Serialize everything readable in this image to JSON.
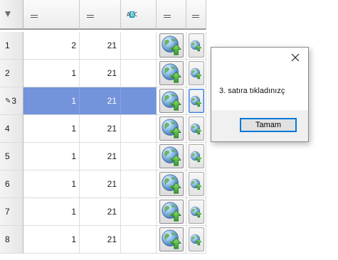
{
  "grid": {
    "header": {
      "filter_icon": "filter-icon",
      "column_icons": [
        "equals-icon",
        "equals-icon",
        "abc-text-icon",
        "equals-icon",
        "equals-icon"
      ],
      "text_type_label": "ABC"
    },
    "rows": [
      {
        "num": "1",
        "a": "2",
        "b": "21",
        "c": "",
        "editing": false,
        "selected": false
      },
      {
        "num": "2",
        "a": "1",
        "b": "21",
        "c": "",
        "editing": false,
        "selected": false
      },
      {
        "num": "3",
        "a": "1",
        "b": "21",
        "c": "",
        "editing": true,
        "selected": true
      },
      {
        "num": "4",
        "a": "1",
        "b": "21",
        "c": "",
        "editing": false,
        "selected": false
      },
      {
        "num": "5",
        "a": "1",
        "b": "21",
        "c": "",
        "editing": false,
        "selected": false
      },
      {
        "num": "6",
        "a": "1",
        "b": "21",
        "c": "",
        "editing": false,
        "selected": false
      },
      {
        "num": "7",
        "a": "1",
        "b": "21",
        "c": "",
        "editing": false,
        "selected": false
      },
      {
        "num": "8",
        "a": "1",
        "b": "21",
        "c": "",
        "editing": false,
        "selected": false
      }
    ],
    "button_icon_large": "globe-upload-icon",
    "button_icon_small": "globe-upload-icon",
    "edit_icon": "pencil-icon",
    "selection_color": "#7393da"
  },
  "dialog": {
    "message": "3. satıra tıkladınızç",
    "ok_label": "Tamam",
    "close_icon": "close-icon"
  }
}
